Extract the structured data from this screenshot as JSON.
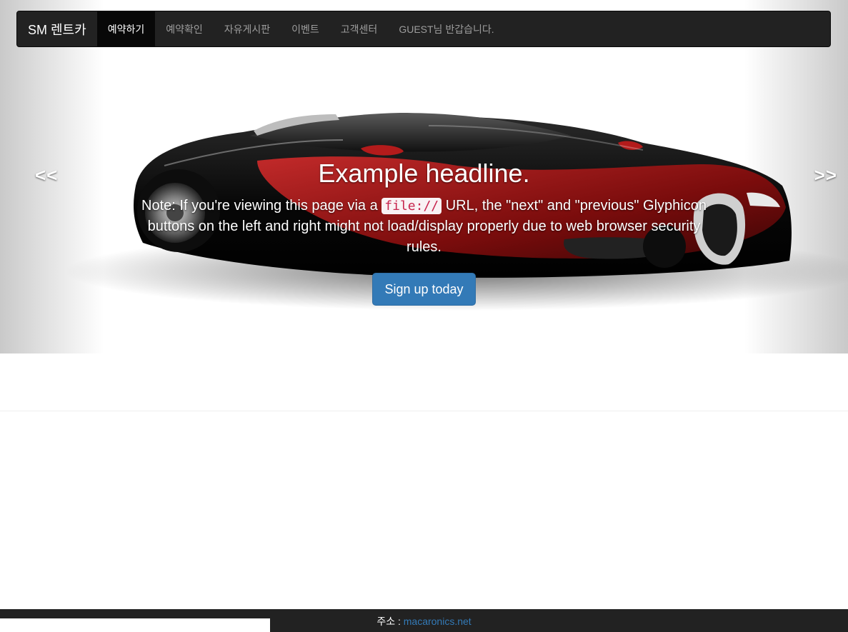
{
  "navbar": {
    "brand": "SM 렌트카",
    "items": [
      {
        "label": "예약하기",
        "active": true
      },
      {
        "label": "예약확인",
        "active": false
      },
      {
        "label": "자유게시판",
        "active": false
      },
      {
        "label": "이벤트",
        "active": false
      },
      {
        "label": "고객센터",
        "active": false
      }
    ],
    "greeting": "GUEST님 반갑습니다."
  },
  "carousel": {
    "prev_label": "<<",
    "next_label": ">>",
    "headline": "Example headline.",
    "note_before": "Note: If you're viewing this page via a ",
    "note_code": "file://",
    "note_after": " URL, the \"next\" and \"previous\" Glyphicon buttons on the left and right might not load/display properly due to web browser security rules.",
    "button_label": "Sign up today",
    "image": "car-image",
    "colors": {
      "car_body": "#0b0b0b",
      "car_accent": "#8e1414"
    }
  },
  "footer": {
    "label": "주소 : ",
    "link": "macaronics.net"
  },
  "colors": {
    "navbar_bg": "#222222",
    "nav_active_bg": "#080808",
    "primary_button": "#337ab7",
    "link": "#337ab7"
  }
}
